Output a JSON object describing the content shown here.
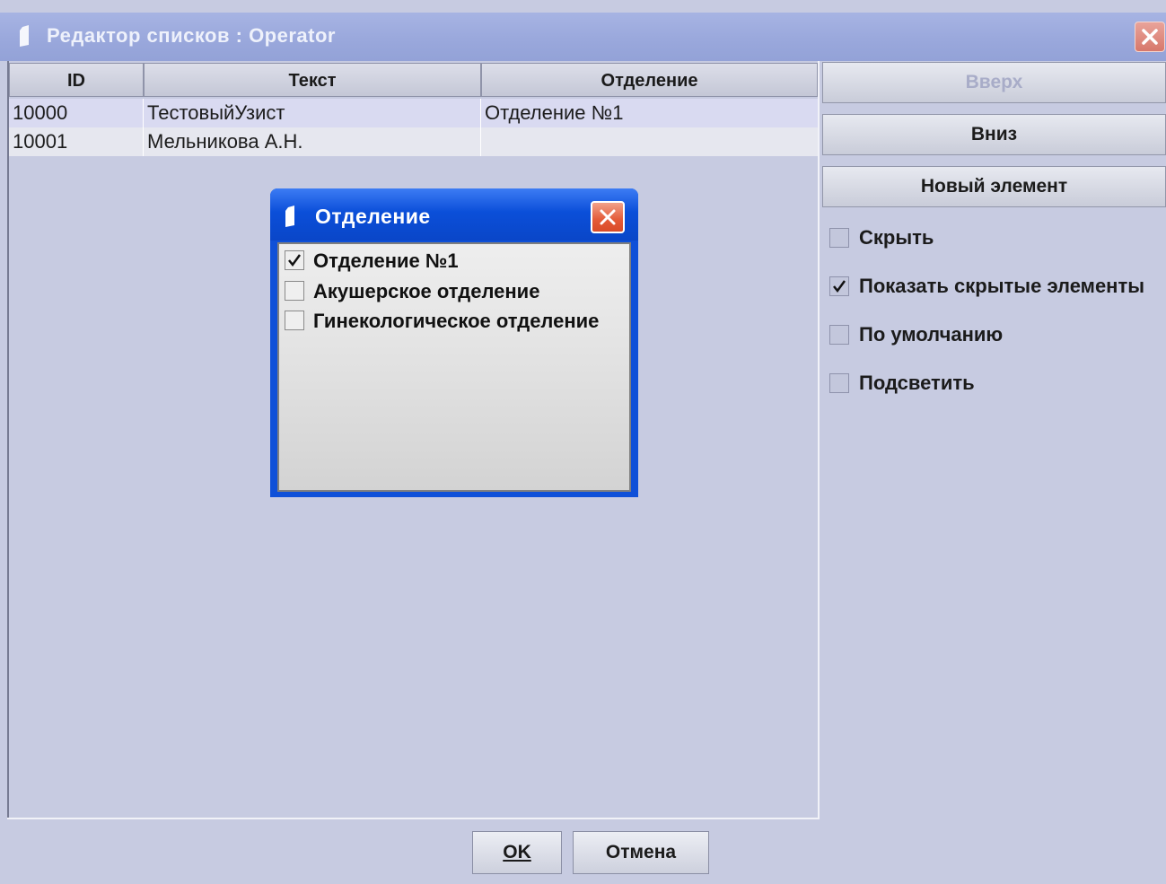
{
  "window": {
    "title": "Редактор списков : Operator"
  },
  "table": {
    "columns": [
      "ID",
      "Текст",
      "Отделение"
    ],
    "rows": [
      {
        "id": "10000",
        "text": "ТестовыйУзист",
        "department": "Отделение №1",
        "selected": true
      },
      {
        "id": "10001",
        "text": "Мельникова А.Н.",
        "department": "",
        "selected": false
      }
    ]
  },
  "side": {
    "up_label": "Вверх",
    "down_label": "Вниз",
    "new_label": "Новый элемент",
    "checkboxes": [
      {
        "label": "Скрыть",
        "checked": false
      },
      {
        "label": "Показать скрытые элементы",
        "checked": true
      },
      {
        "label": "По умолчанию",
        "checked": false
      },
      {
        "label": "Подсветить",
        "checked": false
      }
    ]
  },
  "footer": {
    "ok_label": "OK",
    "cancel_label": "Отмена"
  },
  "popup": {
    "title": "Отделение",
    "items": [
      {
        "label": "Отделение №1",
        "checked": true
      },
      {
        "label": "Акушерское отделение",
        "checked": false
      },
      {
        "label": "Гинекологическое отделение",
        "checked": false
      }
    ]
  },
  "colors": {
    "window_bg": "#c7cbe1",
    "popup_frame": "#0f50d8",
    "disabled_text": "#a8acc8",
    "close_red": "#e45a37"
  }
}
